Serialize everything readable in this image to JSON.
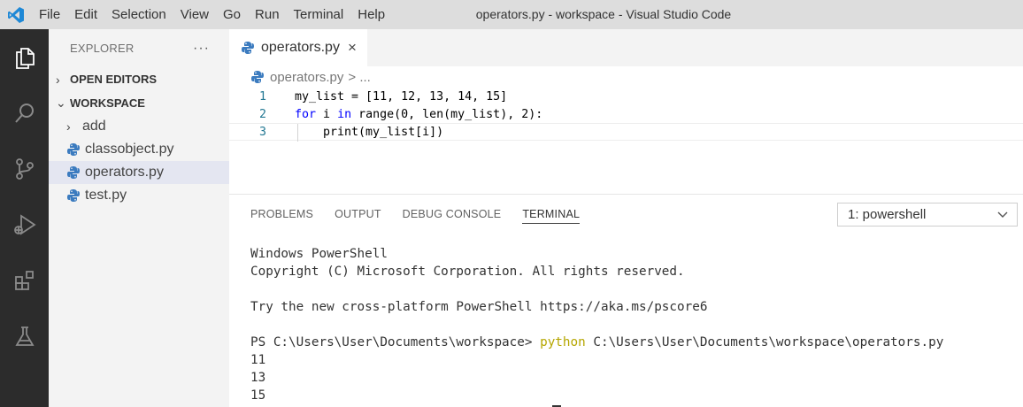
{
  "window": {
    "title": "operators.py - workspace - Visual Studio Code"
  },
  "menu": [
    "File",
    "Edit",
    "Selection",
    "View",
    "Go",
    "Run",
    "Terminal",
    "Help"
  ],
  "activity_bar": [
    {
      "icon": "explorer-icon"
    },
    {
      "icon": "search-icon"
    },
    {
      "icon": "source-control-icon"
    },
    {
      "icon": "run-debug-icon"
    },
    {
      "icon": "extensions-icon"
    },
    {
      "icon": "testing-flask-icon"
    }
  ],
  "sidebar": {
    "header": "EXPLORER",
    "more": "···",
    "open_editors": "OPEN EDITORS",
    "workspace": "WORKSPACE",
    "items": [
      {
        "label": "add",
        "type": "folder"
      },
      {
        "label": "classobject.py",
        "type": "python"
      },
      {
        "label": "operators.py",
        "type": "python",
        "selected": true
      },
      {
        "label": "test.py",
        "type": "python"
      }
    ]
  },
  "editor": {
    "tab": {
      "label": "operators.py",
      "close": "×"
    },
    "breadcrumb": {
      "file": "operators.py",
      "rest": "> ..."
    },
    "lines": [
      {
        "num": "1",
        "text": "my_list = [11, 12, 13, 14, 15]"
      },
      {
        "num": "2",
        "kw1": "for",
        "mid1": " i ",
        "kw2": "in",
        "rest": " range(0, len(my_list), 2):"
      },
      {
        "num": "3",
        "text": "    print(my_list[i])"
      }
    ]
  },
  "panel": {
    "tabs": [
      "PROBLEMS",
      "OUTPUT",
      "DEBUG CONSOLE",
      "TERMINAL"
    ],
    "active_tab": "TERMINAL",
    "terminal_select": "1: powershell",
    "terminal": {
      "line1": "Windows PowerShell",
      "line2": "Copyright (C) Microsoft Corporation. All rights reserved.",
      "line3": "Try the new cross-platform PowerShell https://aka.ms/pscore6",
      "prompt": "PS C:\\Users\\User\\Documents\\workspace> ",
      "cmd": "python",
      "cmd_args": " C:\\Users\\User\\Documents\\workspace\\operators.py",
      "outputs": [
        "11",
        "13",
        "15"
      ]
    }
  },
  "colors": {
    "activity_bar": "#2c2c2c",
    "accent": "#007acc",
    "python_icon": "#3b7bbf"
  }
}
